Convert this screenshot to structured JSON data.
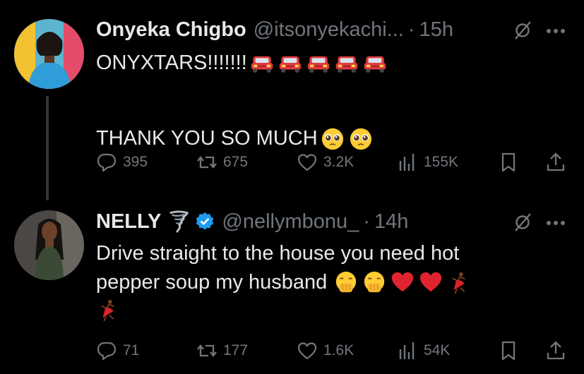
{
  "tweets": [
    {
      "author_name": "Onyeka Chigbo",
      "handle": "@itsonyekachi...",
      "separator": "·",
      "time": "15h",
      "lines": [
        "ONYXTARS!!!!!!!",
        "",
        "THANK YOU SO MUCH"
      ],
      "line1_emojis": [
        "red-car",
        "red-car",
        "red-car",
        "red-car",
        "red-car"
      ],
      "line3_emojis": [
        "pleading-face",
        "pleading-face"
      ],
      "stats": {
        "replies": "395",
        "reposts": "675",
        "likes": "3.2K",
        "views": "155K"
      }
    },
    {
      "author_name": "NELLY",
      "badge_emoji": "tornado",
      "verified": true,
      "handle": "@nellymbonu_",
      "separator": "·",
      "time": "14h",
      "lines": [
        "Drive straight to the house you need hot",
        "pepper soup my husband"
      ],
      "line2_emojis": [
        "hand-over-mouth",
        "hand-over-mouth",
        "red-heart",
        "red-heart",
        "dancer"
      ],
      "line3_emojis": [
        "dancer"
      ],
      "stats": {
        "replies": "71",
        "reposts": "177",
        "likes": "1.6K",
        "views": "54K"
      }
    }
  ],
  "colors": {
    "background": "#000000",
    "text": "#e7e9ea",
    "muted": "#71767b",
    "verified": "#1d9bf0",
    "thread_line": "#333639"
  },
  "icons": [
    "reply-icon",
    "repost-icon",
    "like-icon",
    "views-icon",
    "bookmark-icon",
    "share-icon",
    "grok-icon",
    "more-icon",
    "verified-badge-icon"
  ]
}
